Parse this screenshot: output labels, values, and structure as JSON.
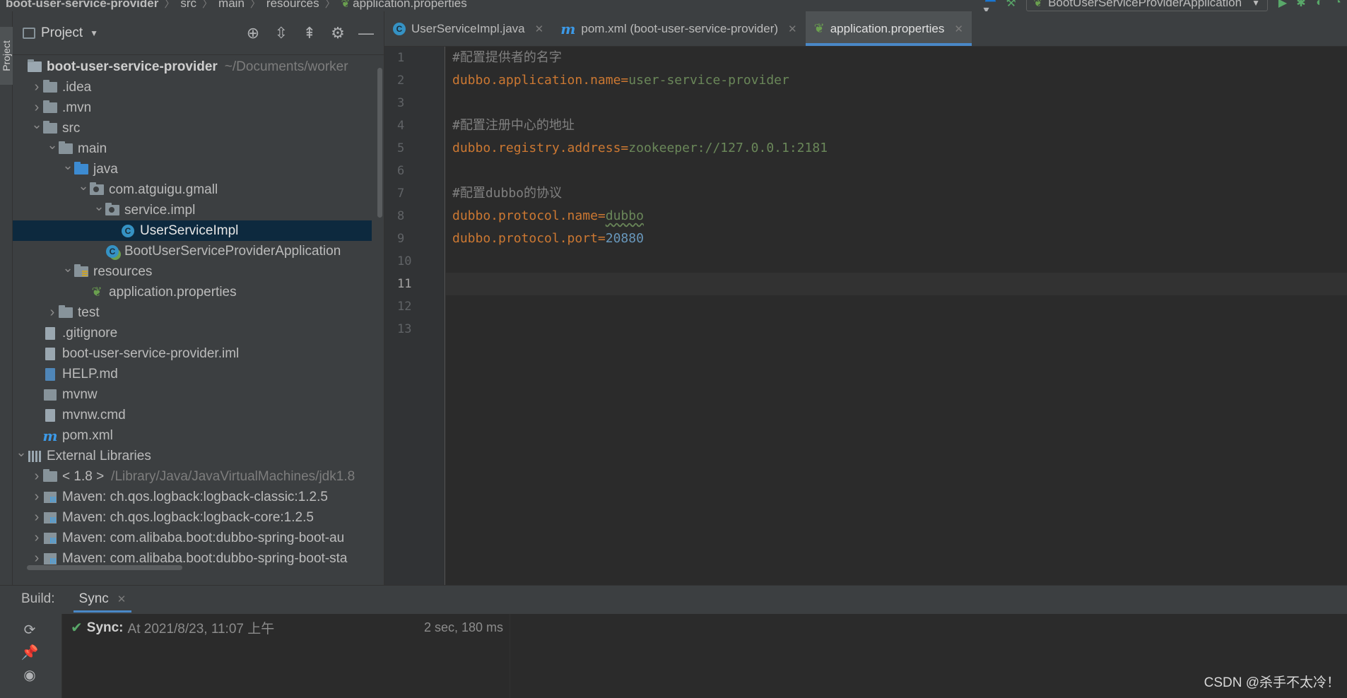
{
  "breadcrumb": [
    "boot-user-service-provider",
    "src",
    "main",
    "resources",
    "application.properties"
  ],
  "run_config": "BootUserServiceProviderApplication",
  "side_strip": {
    "label": "Project"
  },
  "project_panel": {
    "title": "Project",
    "tree": [
      {
        "label": "boot-user-service-provider",
        "hint": "~/Documents/worker",
        "depth": 0,
        "arrow": "",
        "icon": "module",
        "bold": true
      },
      {
        "label": ".idea",
        "depth": 1,
        "arrow": "closed",
        "icon": "folder"
      },
      {
        "label": ".mvn",
        "depth": 1,
        "arrow": "closed",
        "icon": "folder"
      },
      {
        "label": "src",
        "depth": 1,
        "arrow": "open",
        "icon": "folder"
      },
      {
        "label": "main",
        "depth": 2,
        "arrow": "open",
        "icon": "folder"
      },
      {
        "label": "java",
        "depth": 3,
        "arrow": "open",
        "icon": "folder-blue"
      },
      {
        "label": "com.atguigu.gmall",
        "depth": 4,
        "arrow": "open",
        "icon": "package"
      },
      {
        "label": "service.impl",
        "depth": 5,
        "arrow": "open",
        "icon": "package"
      },
      {
        "label": "UserServiceImpl",
        "depth": 6,
        "arrow": "",
        "icon": "class",
        "selected": true
      },
      {
        "label": "BootUserServiceProviderApplication",
        "depth": 5,
        "arrow": "",
        "icon": "spring-class"
      },
      {
        "label": "resources",
        "depth": 3,
        "arrow": "open",
        "icon": "resources"
      },
      {
        "label": "application.properties",
        "depth": 4,
        "arrow": "",
        "icon": "spring-properties"
      },
      {
        "label": "test",
        "depth": 2,
        "arrow": "closed",
        "icon": "folder"
      },
      {
        "label": ".gitignore",
        "depth": 1,
        "arrow": "",
        "icon": "file"
      },
      {
        "label": "boot-user-service-provider.iml",
        "depth": 1,
        "arrow": "",
        "icon": "file"
      },
      {
        "label": "HELP.md",
        "depth": 1,
        "arrow": "",
        "icon": "markdown"
      },
      {
        "label": "mvnw",
        "depth": 1,
        "arrow": "",
        "icon": "script"
      },
      {
        "label": "mvnw.cmd",
        "depth": 1,
        "arrow": "",
        "icon": "file"
      },
      {
        "label": "pom.xml",
        "depth": 1,
        "arrow": "",
        "icon": "maven"
      },
      {
        "label": "External Libraries",
        "depth": 0,
        "arrow": "open",
        "icon": "libraries"
      },
      {
        "label": "< 1.8 >",
        "hint": "/Library/Java/JavaVirtualMachines/jdk1.8",
        "depth": 1,
        "arrow": "closed",
        "icon": "jdk"
      },
      {
        "label": "Maven: ch.qos.logback:logback-classic:1.2.5",
        "depth": 1,
        "arrow": "closed",
        "icon": "maven-lib"
      },
      {
        "label": "Maven: ch.qos.logback:logback-core:1.2.5",
        "depth": 1,
        "arrow": "closed",
        "icon": "maven-lib"
      },
      {
        "label": "Maven: com.alibaba.boot:dubbo-spring-boot-au",
        "depth": 1,
        "arrow": "closed",
        "icon": "maven-lib"
      },
      {
        "label": "Maven: com.alibaba.boot:dubbo-spring-boot-sta",
        "depth": 1,
        "arrow": "closed",
        "icon": "maven-lib"
      }
    ]
  },
  "tabs": [
    {
      "label": "UserServiceImpl.java",
      "icon": "class",
      "active": false
    },
    {
      "label": "pom.xml (boot-user-service-provider)",
      "icon": "maven",
      "active": false
    },
    {
      "label": "application.properties",
      "icon": "spring-properties",
      "active": true
    }
  ],
  "editor": {
    "current_line": 11,
    "lines": [
      {
        "n": "1",
        "type": "comment",
        "text": "#配置提供者的名字"
      },
      {
        "n": "2",
        "type": "prop",
        "key": "dubbo.application.name",
        "value": "user-service-provider",
        "vtype": "str"
      },
      {
        "n": "3",
        "type": "blank"
      },
      {
        "n": "4",
        "type": "comment",
        "text": "#配置注册中心的地址"
      },
      {
        "n": "5",
        "type": "prop",
        "key": "dubbo.registry.address",
        "value": "zookeeper://127.0.0.1:2181",
        "vtype": "str"
      },
      {
        "n": "6",
        "type": "blank"
      },
      {
        "n": "7",
        "type": "comment",
        "text": "#配置dubbo的协议"
      },
      {
        "n": "8",
        "type": "prop",
        "key": "dubbo.protocol.name",
        "value": "dubbo",
        "vtype": "str-typo"
      },
      {
        "n": "9",
        "type": "prop",
        "key": "dubbo.protocol.port",
        "value": "20880",
        "vtype": "num"
      },
      {
        "n": "10",
        "type": "blank"
      },
      {
        "n": "11",
        "type": "blank"
      },
      {
        "n": "12",
        "type": "blank"
      },
      {
        "n": "13",
        "type": "blank"
      }
    ]
  },
  "build": {
    "label": "Build:",
    "tab": "Sync",
    "sync_name": "Sync:",
    "sync_time": "At 2021/8/23, 11:07 上午",
    "sync_duration": "2 sec, 180 ms"
  },
  "watermark": "CSDN @杀手不太冷！",
  "colors": {
    "accent": "#4a88c7",
    "selection": "#0d293e",
    "keyword": "#cc7832",
    "string": "#6a8759",
    "number": "#6897bb",
    "comment": "#808080"
  }
}
